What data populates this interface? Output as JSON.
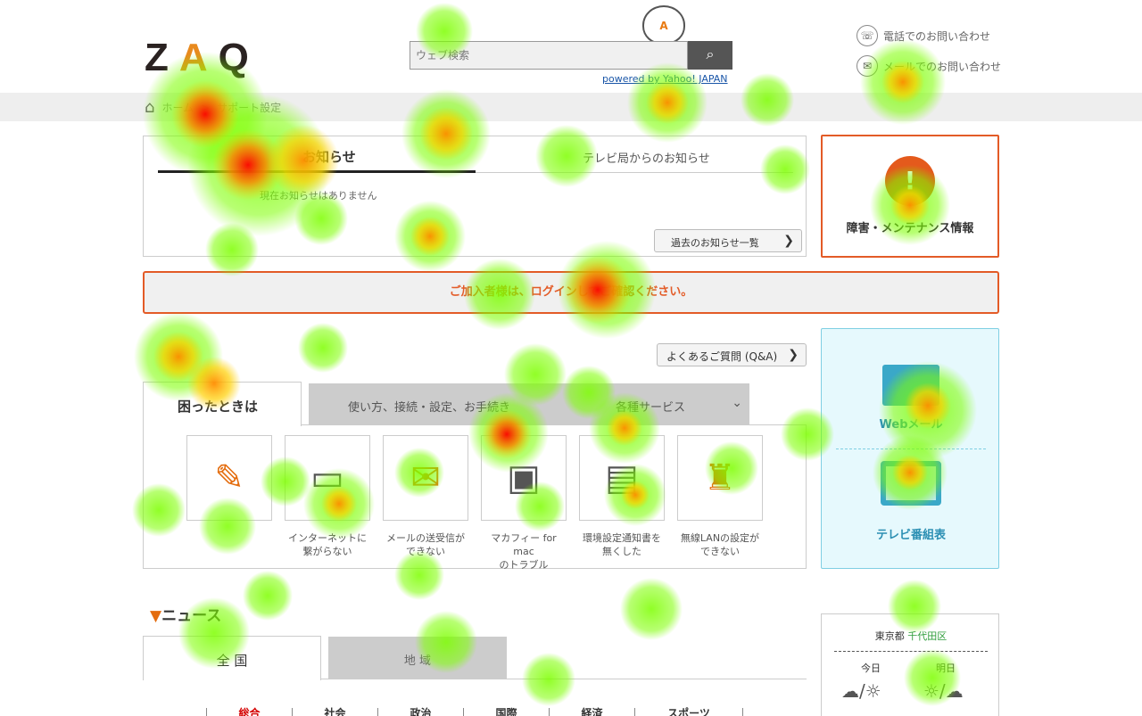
{
  "header": {
    "logo": "ZAQ",
    "mascot_label": "A",
    "search_placeholder": "ウェブ検索",
    "search_button": "⌕",
    "powered_by": "powered by Yahoo! JAPAN",
    "contact_phone": "電話でのお問い合わせ",
    "contact_mail": "メールでのお問い合わせ"
  },
  "breadcrumb": {
    "home_icon": "⌂",
    "items": [
      "ホーム",
      "サポート設定"
    ]
  },
  "notices": {
    "tab_main": "お知らせ",
    "tab_tv": "テレビ局からのお知らせ",
    "empty": "現在お知らせはありません",
    "past_button": "過去のお知らせ一覧",
    "outage_icon": "!",
    "outage_label": "障害・メンテナンス情報",
    "warning": "ご加入者様は、ログインしてご確認ください。"
  },
  "support": {
    "faq_button": "よくあるご質問 (Q&A)",
    "tab_trouble": "困ったときは",
    "tab_usage": "使い方、接続・設定、お手続き",
    "tab_services": "各種サービス",
    "items": [
      {
        "icon": "pencil-icon",
        "glyph": "✎",
        "caption_line1": "",
        "caption_line2": ""
      },
      {
        "icon": "monitor-icon",
        "glyph": "▭",
        "caption_line1": "インターネットに",
        "caption_line2": "繋がらない"
      },
      {
        "icon": "mail-error-icon",
        "glyph": "✉",
        "caption_line1": "メールの送受信が",
        "caption_line2": "できない"
      },
      {
        "icon": "shield-icon",
        "glyph": "▣",
        "caption_line1": "マカフィー for mac",
        "caption_line2": "のトラブル"
      },
      {
        "icon": "document-icon",
        "glyph": "▤",
        "caption_line1": "環境設定通知書を",
        "caption_line2": "無くした"
      },
      {
        "icon": "wifi-tower-icon",
        "glyph": "♜",
        "caption_line1": "無線LANの設定が",
        "caption_line2": "できない"
      }
    ],
    "side_web_label": "Webメール",
    "side_tv_label": "テレビ番組表"
  },
  "news": {
    "heading": "ニュース",
    "tab_national": "全 国",
    "tab_regional": "地 域",
    "categories": [
      "総合",
      "社会",
      "政治",
      "国際",
      "経済",
      "スポーツ"
    ]
  },
  "weather": {
    "pref": "東京都",
    "ward": "千代田区",
    "today": "今日",
    "tomorrow": "明日",
    "today_icon": "☁/☼",
    "tomorrow_icon": "☼/☁"
  },
  "colors": {
    "accent_orange": "#e35b27",
    "service_blue": "#2b8fb3",
    "news_active": "#d40000"
  }
}
